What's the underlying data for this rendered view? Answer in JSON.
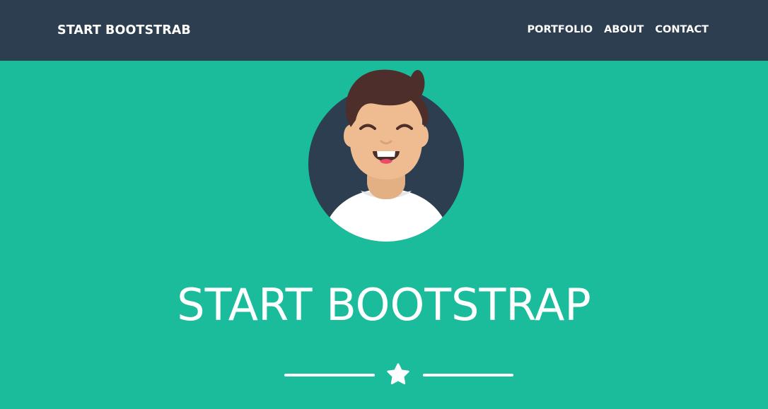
{
  "navbar": {
    "brand": "START BOOTSTRAB",
    "links": [
      {
        "label": "PORTFOLIO"
      },
      {
        "label": "ABOUT"
      },
      {
        "label": "CONTACT"
      }
    ]
  },
  "masthead": {
    "avatar_icon": "avatar-illustration",
    "heading": "START BOOTSTRAP",
    "divider_icon": "star-icon"
  },
  "colors": {
    "nav_background": "#2c3e50",
    "hero_background": "#1abc9c",
    "text": "#ffffff",
    "avatar_circle": "#2c3e50",
    "hair": "#4e2e2a",
    "skin": "#efbc91",
    "shirt": "#ffffff"
  }
}
